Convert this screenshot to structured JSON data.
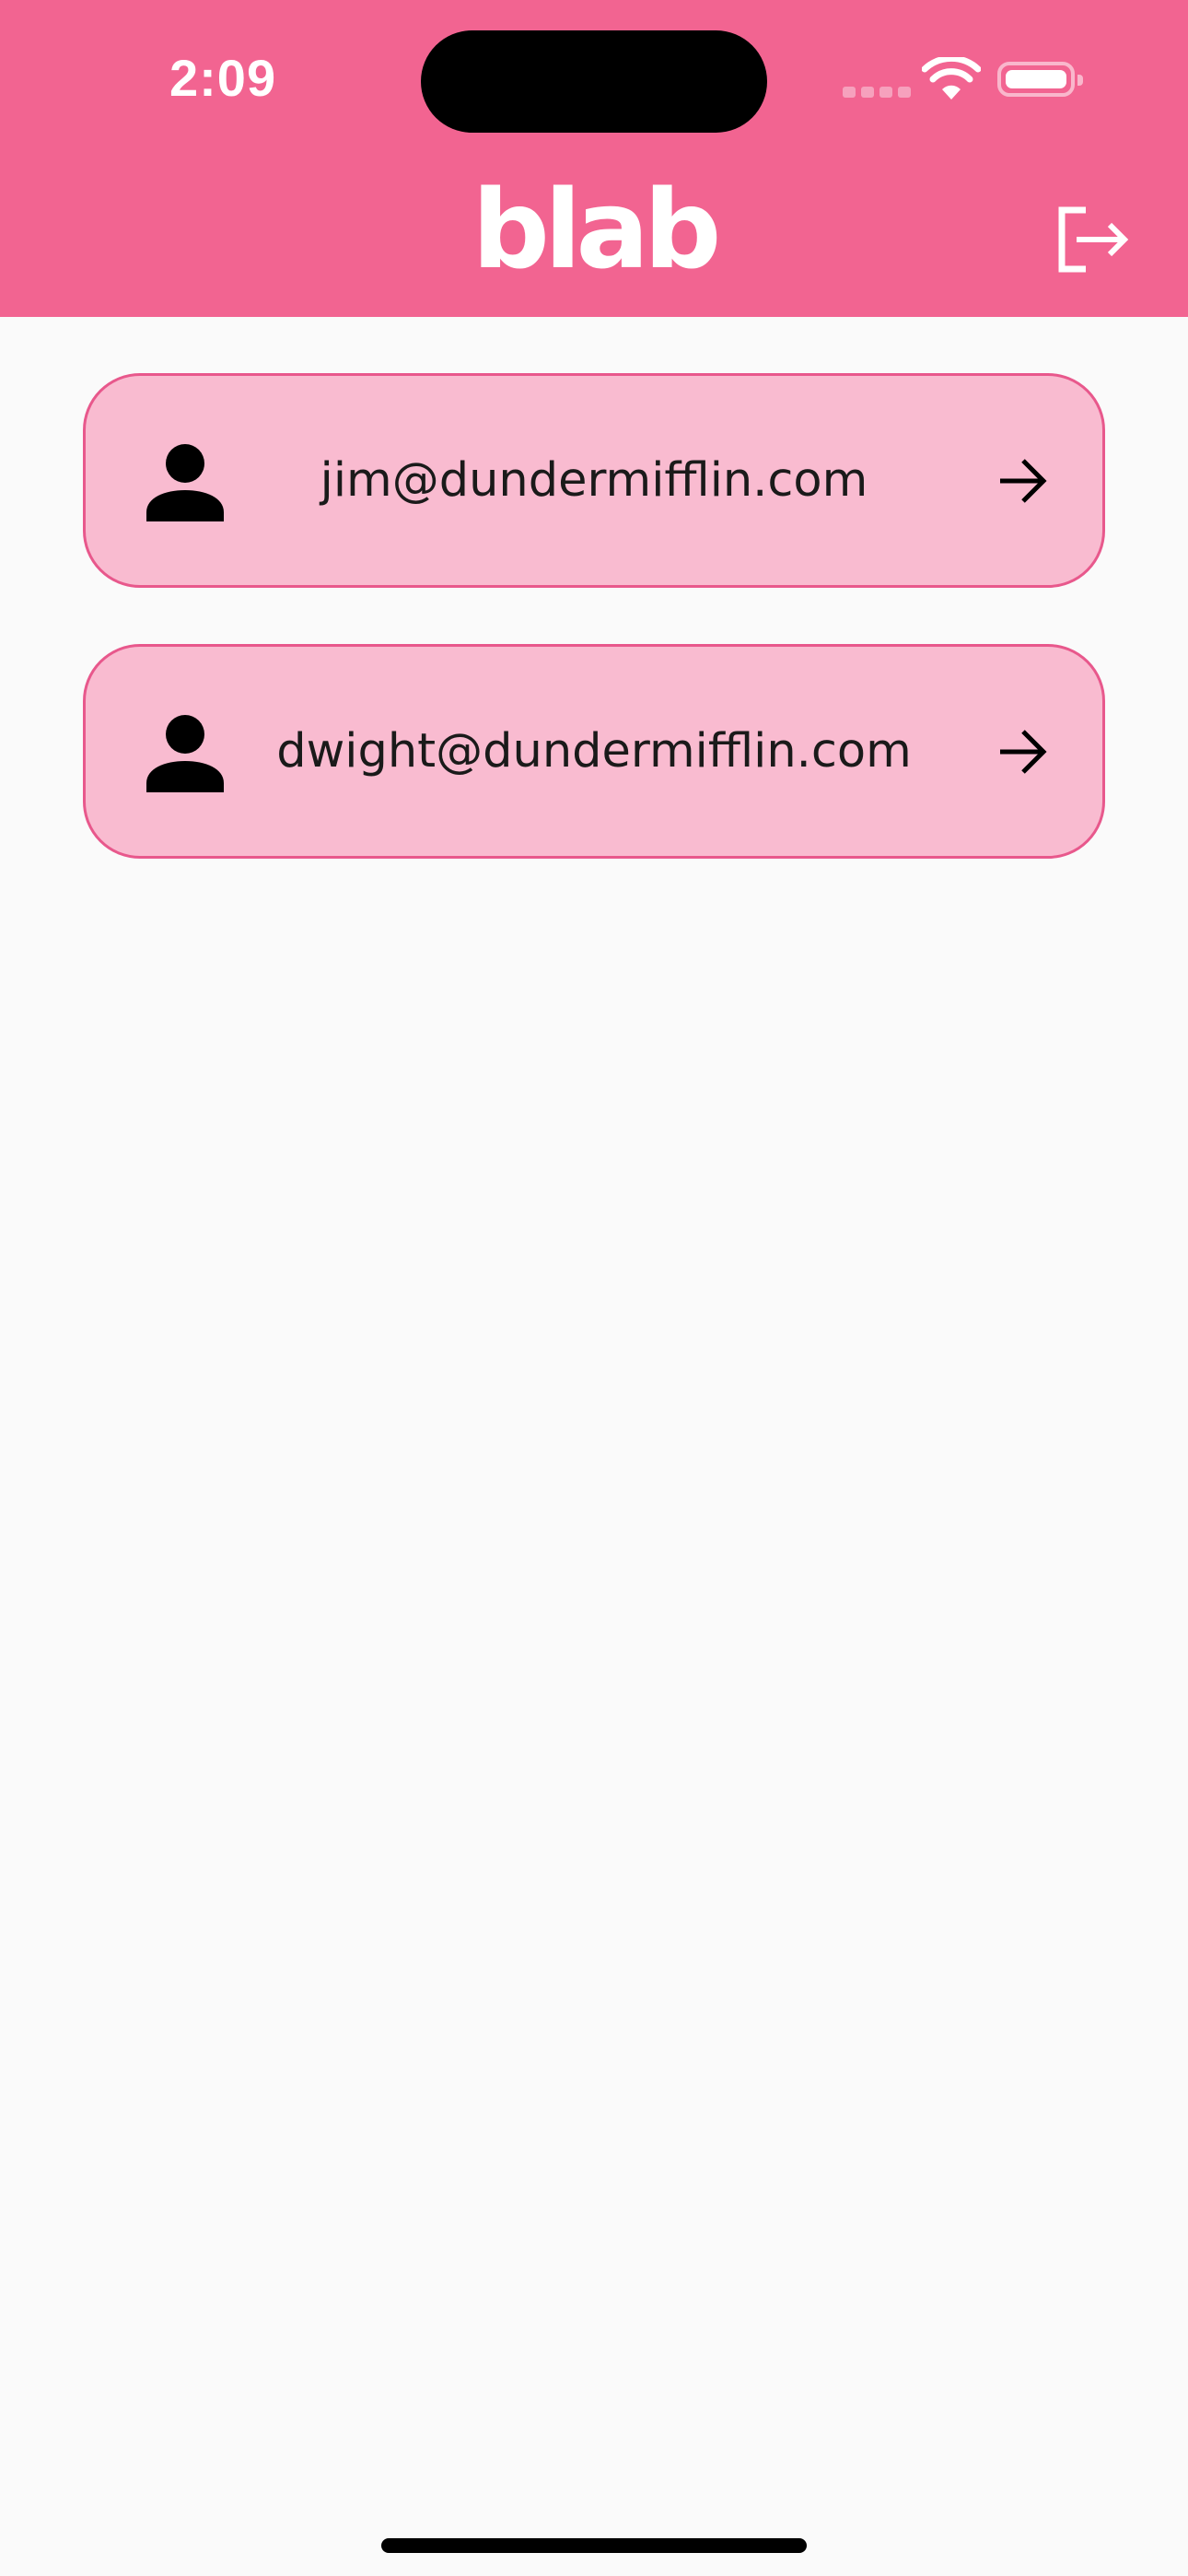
{
  "status_bar": {
    "time": "2:09",
    "icons": [
      "signal-icon",
      "wifi-icon",
      "battery-icon"
    ]
  },
  "header": {
    "title": "blab",
    "logout_icon": "logout-icon",
    "color": "#f26491"
  },
  "users": [
    {
      "email": "jim@dundermifflin.com",
      "icon": "person-icon",
      "action_icon": "arrow-right-icon"
    },
    {
      "email": "dwight@dundermifflin.com",
      "icon": "person-icon",
      "action_icon": "arrow-right-icon"
    }
  ],
  "colors": {
    "accent": "#f26491",
    "card_bg": "#f9bbd0",
    "card_border": "#e8588c",
    "background": "#fafafa"
  }
}
